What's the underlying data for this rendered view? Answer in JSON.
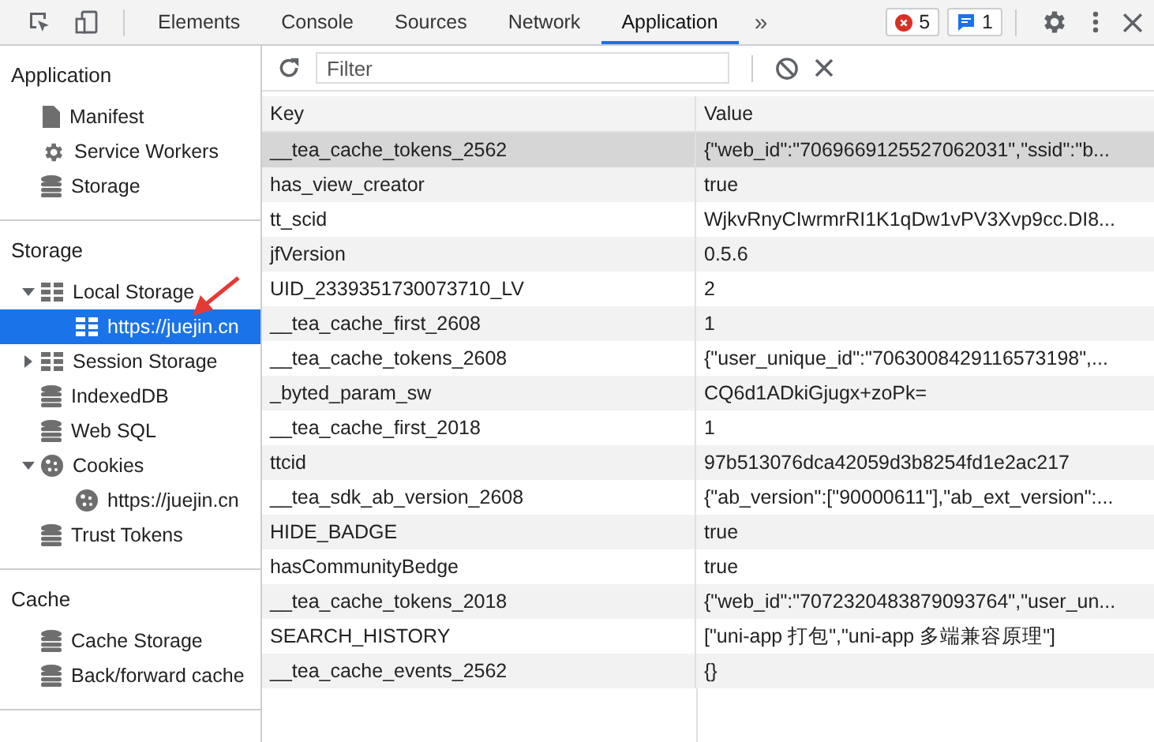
{
  "toolbar_tabs": [
    {
      "label": "Elements",
      "selected": false
    },
    {
      "label": "Console",
      "selected": false
    },
    {
      "label": "Sources",
      "selected": false
    },
    {
      "label": "Network",
      "selected": false
    },
    {
      "label": "Application",
      "selected": true
    }
  ],
  "more_tabs": "»",
  "counters": [
    {
      "kind": "error",
      "count": "5"
    },
    {
      "kind": "message",
      "count": "1"
    }
  ],
  "sidebar": {
    "sections": [
      {
        "title": "Application",
        "items": [
          {
            "label": "Manifest",
            "kind": "file",
            "selected": false
          },
          {
            "label": "Service Workers",
            "kind": "gear",
            "selected": false
          },
          {
            "label": "Storage",
            "kind": "database",
            "selected": false
          }
        ]
      },
      {
        "title": "Storage",
        "items": [
          {
            "label": "Local Storage",
            "kind": "grid",
            "selected": false,
            "expanded": true,
            "children": [
              {
                "label": "https://juejin.cn",
                "kind": "grid",
                "selected": true
              }
            ]
          },
          {
            "label": "Session Storage",
            "kind": "grid",
            "selected": false,
            "expanded": false
          },
          {
            "label": "IndexedDB",
            "kind": "database",
            "selected": false
          },
          {
            "label": "Web SQL",
            "kind": "database",
            "selected": false
          },
          {
            "label": "Cookies",
            "kind": "cookie",
            "selected": false,
            "expanded": true,
            "children": [
              {
                "label": "https://juejin.cn",
                "kind": "cookie",
                "selected": false
              }
            ]
          },
          {
            "label": "Trust Tokens",
            "kind": "database",
            "selected": false
          }
        ]
      },
      {
        "title": "Cache",
        "items": [
          {
            "label": "Cache Storage",
            "kind": "database",
            "selected": false
          },
          {
            "label": "Back/forward cache",
            "kind": "database",
            "selected": false
          }
        ]
      }
    ]
  },
  "filter": {
    "placeholder": "Filter"
  },
  "table": {
    "columns": [
      "Key",
      "Value"
    ],
    "rows": [
      {
        "key": "__tea_cache_tokens_2562",
        "value": "{\"web_id\":\"7069669125527062031\",\"ssid\":\"b...",
        "selected": true
      },
      {
        "key": "has_view_creator",
        "value": "true",
        "selected": false
      },
      {
        "key": "tt_scid",
        "value": "WjkvRnyCIwrmrRI1K1qDw1vPV3Xvp9cc.DI8...",
        "selected": false
      },
      {
        "key": "jfVersion",
        "value": "0.5.6",
        "selected": false
      },
      {
        "key": "UID_2339351730073710_LV",
        "value": "2",
        "selected": false
      },
      {
        "key": "__tea_cache_first_2608",
        "value": "1",
        "selected": false
      },
      {
        "key": "__tea_cache_tokens_2608",
        "value": "{\"user_unique_id\":\"7063008429116573198\",...",
        "selected": false
      },
      {
        "key": "_byted_param_sw",
        "value": "CQ6d1ADkiGjugx+zoPk=",
        "selected": false
      },
      {
        "key": "__tea_cache_first_2018",
        "value": "1",
        "selected": false
      },
      {
        "key": "ttcid",
        "value": "97b513076dca42059d3b8254fd1e2ac217",
        "selected": false
      },
      {
        "key": "__tea_sdk_ab_version_2608",
        "value": "{\"ab_version\":[\"90000611\"],\"ab_ext_version\":...",
        "selected": false
      },
      {
        "key": "HIDE_BADGE",
        "value": "true",
        "selected": false
      },
      {
        "key": "hasCommunityBedge",
        "value": "true",
        "selected": false
      },
      {
        "key": "__tea_cache_tokens_2018",
        "value": "{\"web_id\":\"7072320483879093764\",\"user_un...",
        "selected": false
      },
      {
        "key": "SEARCH_HISTORY",
        "value": "[\"uni-app 打包\",\"uni-app 多端兼容原理\"]",
        "selected": false
      },
      {
        "key": "__tea_cache_events_2562",
        "value": "{}",
        "selected": false
      }
    ]
  }
}
